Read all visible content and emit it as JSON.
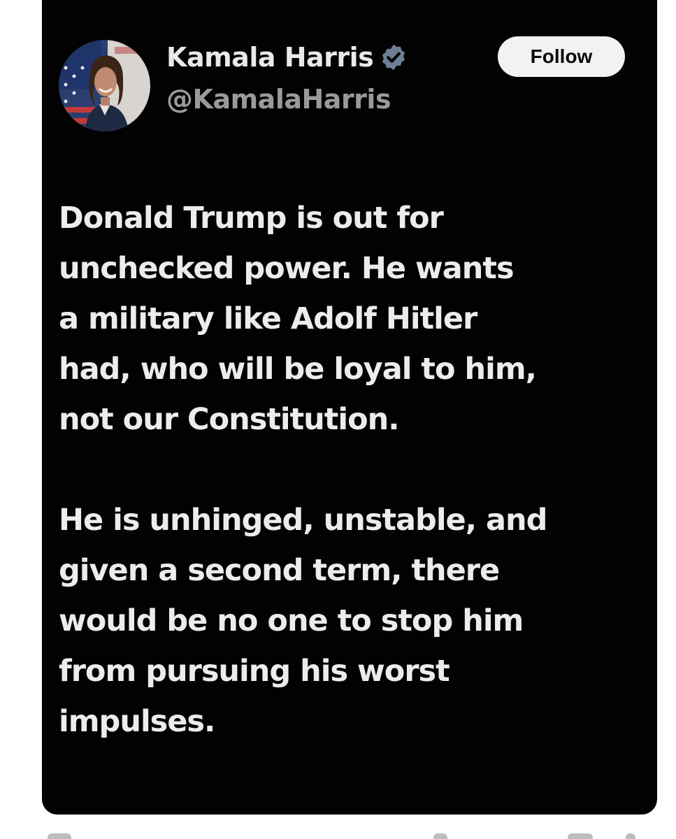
{
  "user": {
    "display_name": "Kamala Harris",
    "handle": "@KamalaHarris",
    "verified_icon": "verified-badge-icon",
    "badge_color": "#6e7f94"
  },
  "follow_button": {
    "label": "Follow"
  },
  "tweet": {
    "paragraph_1": [
      "Donald Trump is out for",
      "unchecked power. He wants",
      "a military like Adolf Hitler",
      "had, who will be loyal to him,",
      "not our Constitution."
    ],
    "paragraph_2": [
      "He is unhinged, unstable, and",
      "given a second term, there",
      "would be no one to stop him",
      "from pursuing his worst",
      "impulses."
    ]
  },
  "colors": {
    "card_background": "#020202",
    "page_background": "#ffffff",
    "text_primary": "#ececec",
    "text_secondary": "#9a9a9a",
    "follow_button_background": "#f2f2f2"
  }
}
